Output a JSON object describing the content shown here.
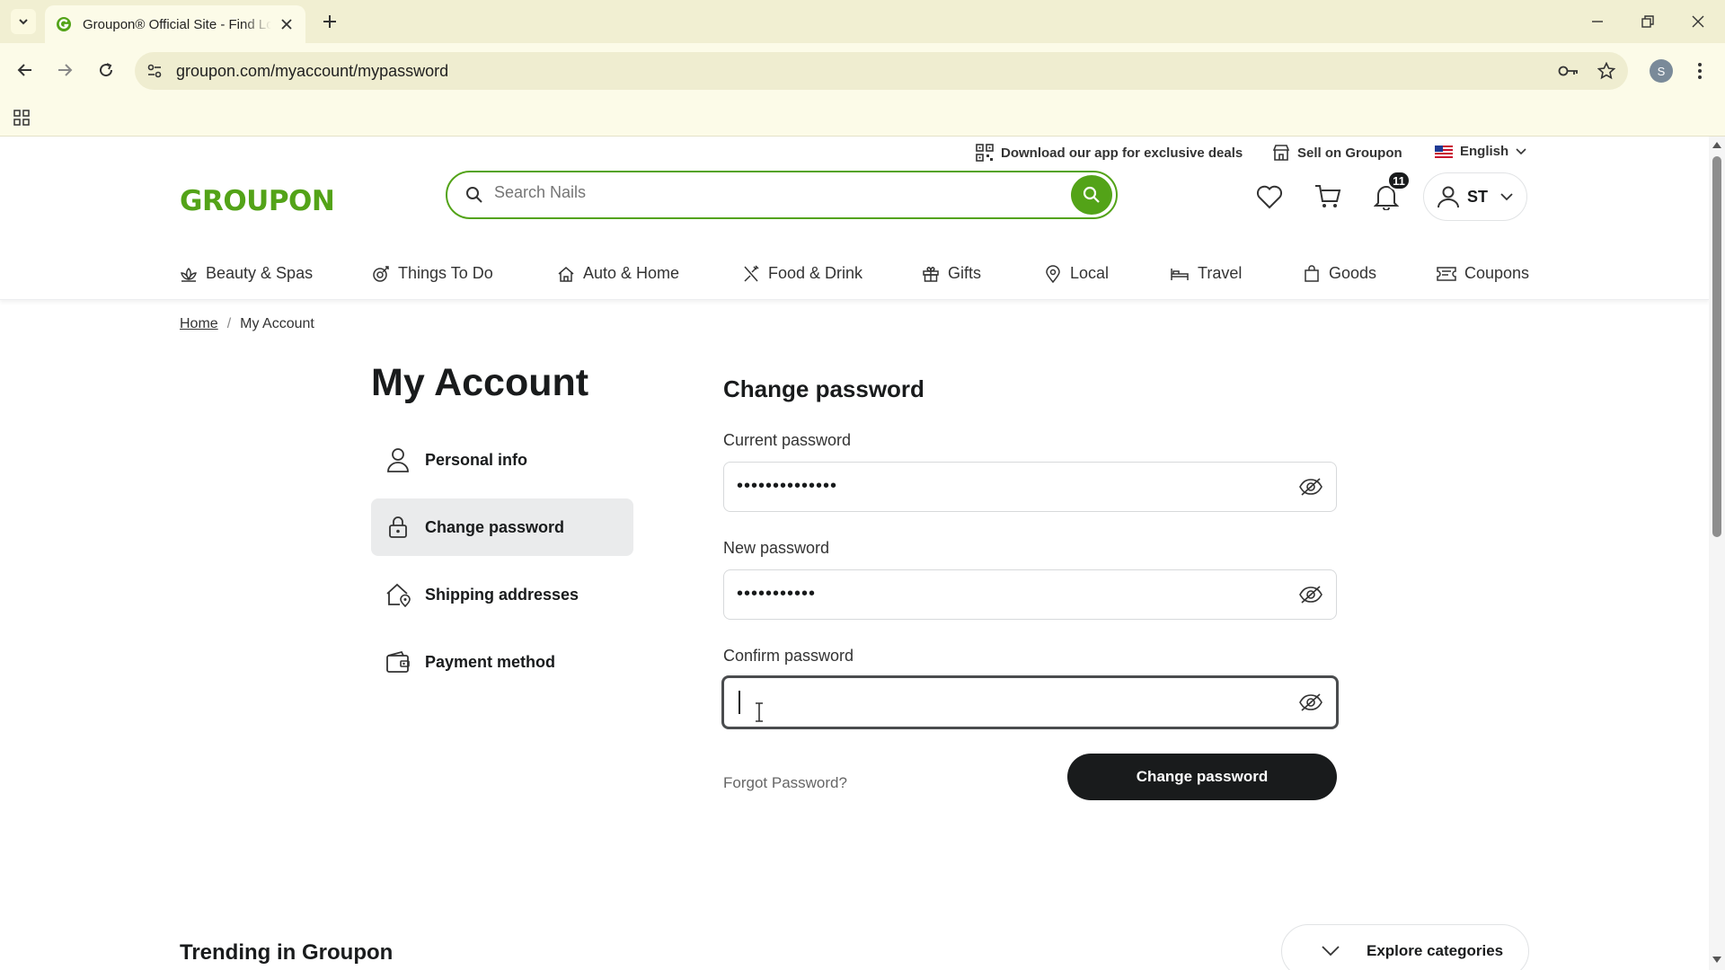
{
  "browser": {
    "tab_title": "Groupon® Official Site - Find Local Deals",
    "url": "groupon.com/myaccount/mypassword",
    "profile_initial": "S"
  },
  "utility_bar": {
    "download_app": "Download our app for exclusive deals",
    "sell": "Sell on Groupon",
    "language": "English"
  },
  "header": {
    "logo": "GROUPON",
    "search_placeholder": "Search Nails",
    "notification_count": "11",
    "user_initials": "ST"
  },
  "categories": [
    {
      "label": "Beauty & Spas",
      "icon": "lotus-icon"
    },
    {
      "label": "Things To Do",
      "icon": "activity-icon"
    },
    {
      "label": "Auto & Home",
      "icon": "home-icon"
    },
    {
      "label": "Food & Drink",
      "icon": "utensils-icon"
    },
    {
      "label": "Gifts",
      "icon": "gift-icon"
    },
    {
      "label": "Local",
      "icon": "location-pin-icon"
    },
    {
      "label": "Travel",
      "icon": "bed-icon"
    },
    {
      "label": "Goods",
      "icon": "shopping-bag-icon"
    },
    {
      "label": "Coupons",
      "icon": "coupon-icon"
    }
  ],
  "breadcrumb": {
    "home": "Home",
    "separator": "/",
    "current": "My Account"
  },
  "sidebar": {
    "title": "My Account",
    "items": [
      {
        "label": "Personal info",
        "icon": "person-icon",
        "active": false
      },
      {
        "label": "Change password",
        "icon": "lock-icon",
        "active": true
      },
      {
        "label": "Shipping addresses",
        "icon": "home-location-icon",
        "active": false
      },
      {
        "label": "Payment method",
        "icon": "wallet-icon",
        "active": false
      }
    ]
  },
  "form": {
    "title": "Change password",
    "current_label": "Current password",
    "current_value": "••••••••••••••",
    "new_label": "New password",
    "new_value": "•••••••••••",
    "confirm_label": "Confirm password",
    "confirm_value": "",
    "forgot": "Forgot Password?",
    "submit": "Change password"
  },
  "footer": {
    "trending": "Trending in Groupon",
    "explore": "Explore categories"
  },
  "colors": {
    "brand_green": "#53a318",
    "dark": "#191b1c",
    "chrome_bg": "#fcfbe8"
  }
}
